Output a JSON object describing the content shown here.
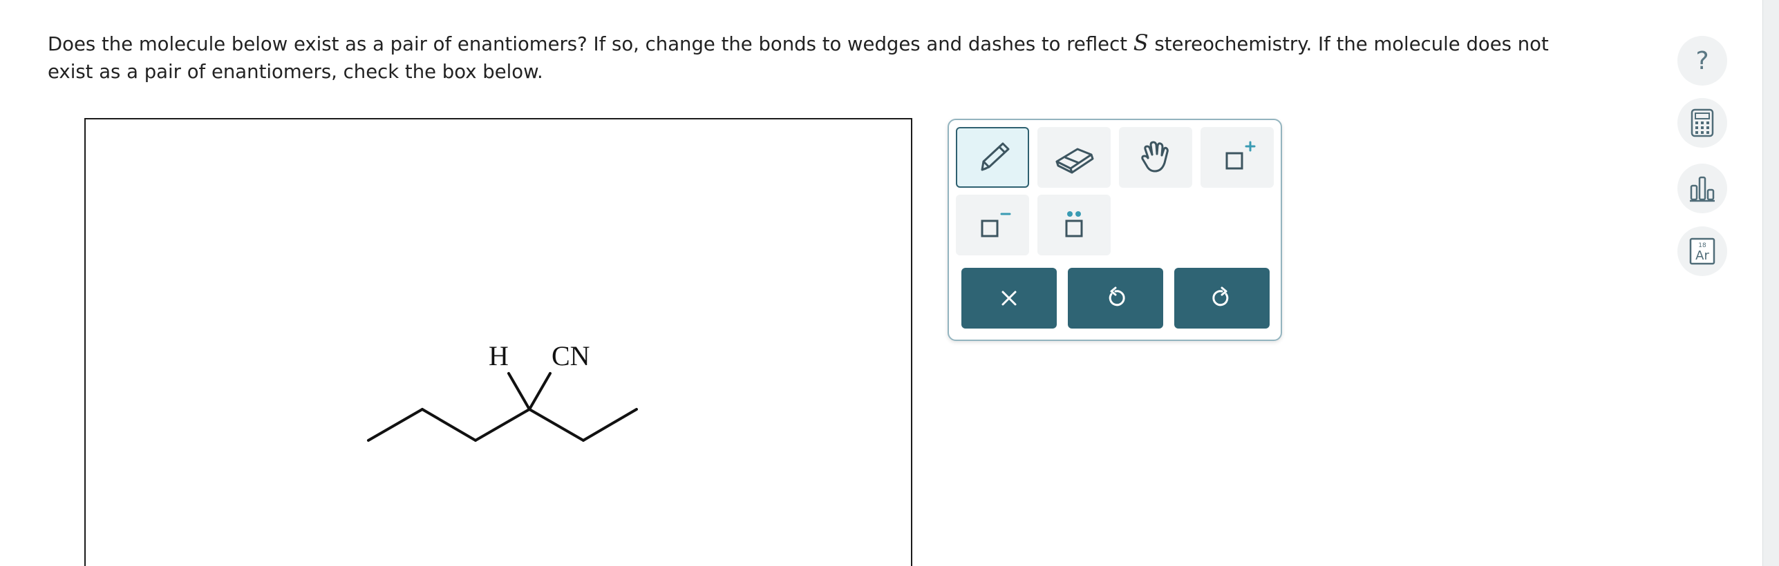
{
  "question": {
    "part1": "Does the molecule below exist as a pair of enantiomers? If so, change the bonds to wedges and dashes to reflect ",
    "variable": "S",
    "part2": " stereochemistry. If the molecule does not exist as a pair of enantiomers, check the box below."
  },
  "molecule": {
    "label_h": "H",
    "label_cn": "CN"
  },
  "toolbar": {
    "tools": [
      {
        "icon": "pencil-icon",
        "active": true
      },
      {
        "icon": "eraser-icon",
        "active": false
      },
      {
        "icon": "hand-icon",
        "active": false
      },
      {
        "icon": "add-positive-charge-icon",
        "active": false
      },
      {
        "icon": "add-negative-charge-icon",
        "active": false
      },
      {
        "icon": "lone-pair-icon",
        "active": false
      }
    ],
    "actions": [
      {
        "icon": "clear-icon"
      },
      {
        "icon": "undo-icon"
      },
      {
        "icon": "redo-icon"
      }
    ]
  },
  "sidebar": {
    "help_label": "?",
    "periodic_number": "18",
    "periodic_symbol": "Ar",
    "icons": [
      "help-icon",
      "calculator-icon",
      "bar-chart-icon",
      "periodic-table-icon"
    ]
  },
  "colors": {
    "accent": "#2f6474",
    "tool_bg": "#f1f3f4",
    "active_tool_bg": "#e3f3f7",
    "icon_gray": "#5b7884",
    "charge_teal": "#3a9bb3"
  }
}
